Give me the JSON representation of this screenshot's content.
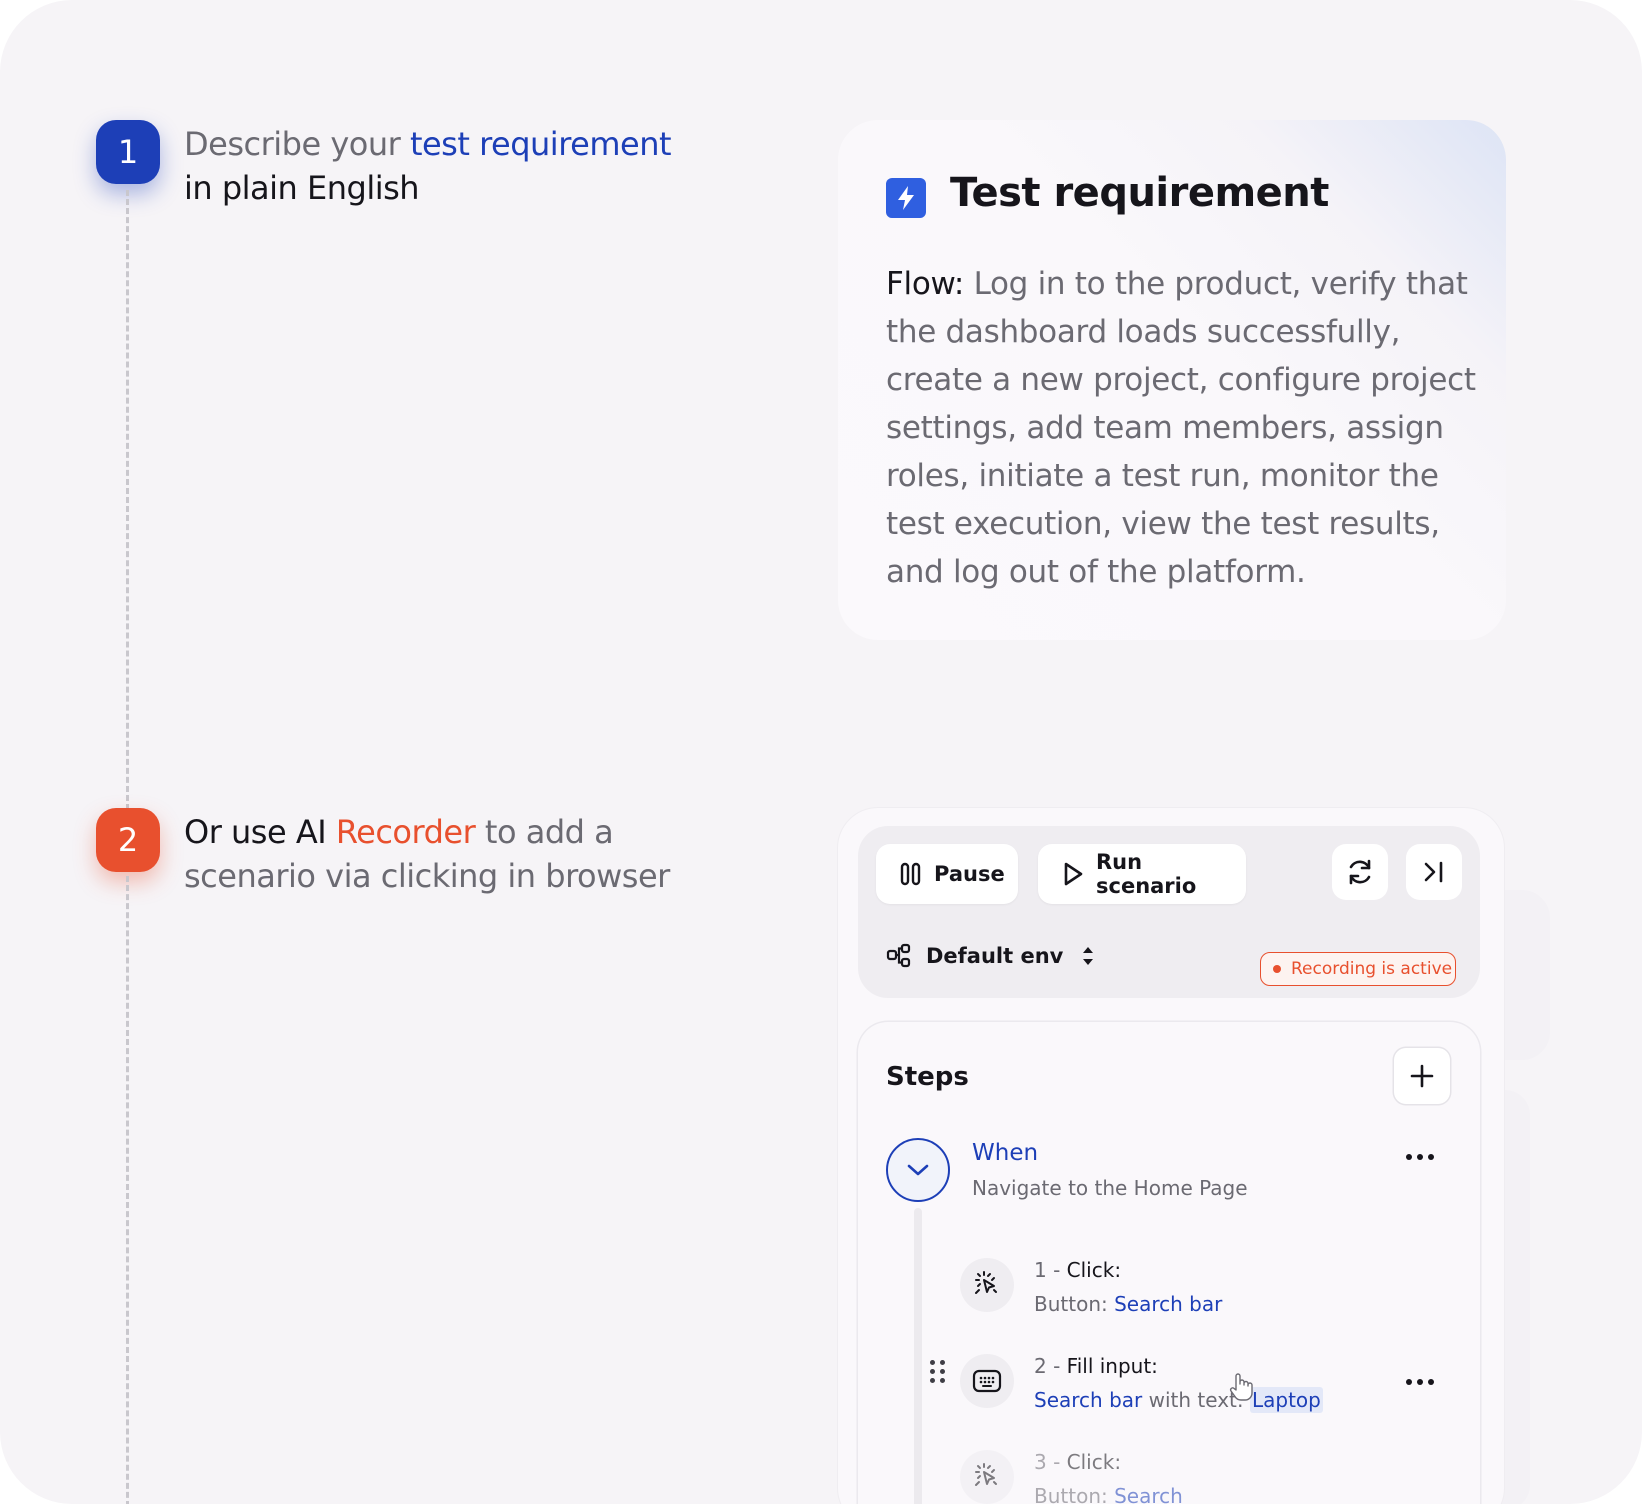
{
  "step1": {
    "number": "1",
    "text_a": "Describe your ",
    "highlight": "test requirement",
    "text_b": " in plain English"
  },
  "step2": {
    "number": "2",
    "text_a": "Or use AI ",
    "highlight": "Recorder",
    "text_b": " to add a scenario via clicking in browser"
  },
  "requirement_card": {
    "title": "Test requirement",
    "flow_label": "Flow:",
    "flow_text": " Log in to the product, verify that the dashboard loads successfully, create a new project, configure project settings, add team members, assign roles, initiate a test run, monitor the test execution, view the test results, and log out of the platform."
  },
  "recorder": {
    "pause_label": "Pause",
    "run_label": "Run scenario",
    "env_label": "Default env",
    "recording_status": "Recording is active",
    "steps_title": "Steps",
    "when_title": "When",
    "when_subtitle": "Navigate to the Home Page",
    "steps": [
      {
        "num": "1 - ",
        "action": "Click:",
        "detail_prefix": "Button: ",
        "target": "Search bar"
      },
      {
        "num": "2 - ",
        "action": "Fill input:",
        "target": "Search bar",
        "detail_mid": " with text: ",
        "value": "Laptop"
      },
      {
        "num": "3 - ",
        "action": "Click:",
        "detail_prefix": "Button: ",
        "target": "Search"
      }
    ]
  },
  "colors": {
    "blue": "#1d3fb7",
    "orange": "#e8502e",
    "background": "#f6f4f7"
  },
  "icons": [
    "bolt-icon",
    "pause-icon",
    "play-icon",
    "refresh-icon",
    "skip-to-end-icon",
    "environment-icon",
    "sort-icon",
    "plus-icon",
    "chevron-down-icon",
    "more-icon",
    "click-icon",
    "keyboard-icon",
    "drag-handle-icon",
    "hand-cursor-icon"
  ]
}
